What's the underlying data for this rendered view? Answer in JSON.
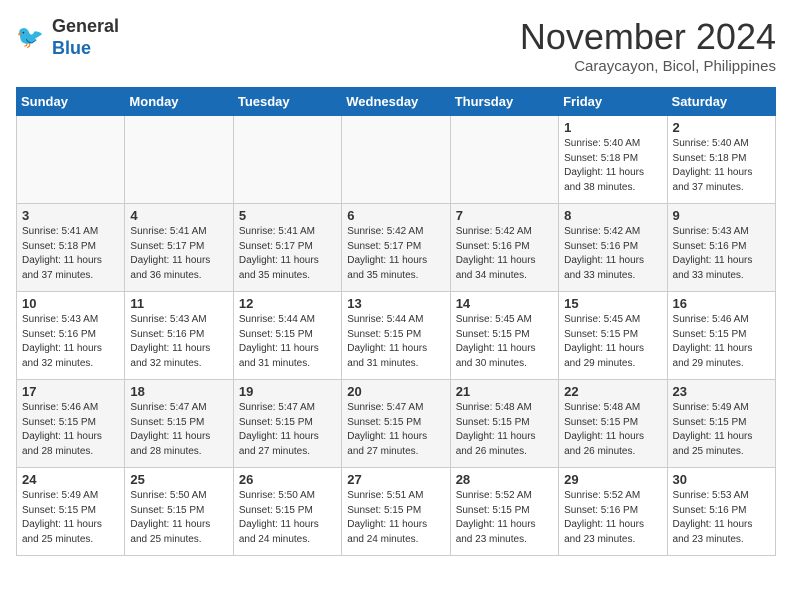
{
  "header": {
    "logo_line1": "General",
    "logo_line2": "Blue",
    "month": "November 2024",
    "location": "Caraycayon, Bicol, Philippines"
  },
  "weekdays": [
    "Sunday",
    "Monday",
    "Tuesday",
    "Wednesday",
    "Thursday",
    "Friday",
    "Saturday"
  ],
  "weeks": [
    [
      {
        "day": "",
        "info": ""
      },
      {
        "day": "",
        "info": ""
      },
      {
        "day": "",
        "info": ""
      },
      {
        "day": "",
        "info": ""
      },
      {
        "day": "",
        "info": ""
      },
      {
        "day": "1",
        "info": "Sunrise: 5:40 AM\nSunset: 5:18 PM\nDaylight: 11 hours\nand 38 minutes."
      },
      {
        "day": "2",
        "info": "Sunrise: 5:40 AM\nSunset: 5:18 PM\nDaylight: 11 hours\nand 37 minutes."
      }
    ],
    [
      {
        "day": "3",
        "info": "Sunrise: 5:41 AM\nSunset: 5:18 PM\nDaylight: 11 hours\nand 37 minutes."
      },
      {
        "day": "4",
        "info": "Sunrise: 5:41 AM\nSunset: 5:17 PM\nDaylight: 11 hours\nand 36 minutes."
      },
      {
        "day": "5",
        "info": "Sunrise: 5:41 AM\nSunset: 5:17 PM\nDaylight: 11 hours\nand 35 minutes."
      },
      {
        "day": "6",
        "info": "Sunrise: 5:42 AM\nSunset: 5:17 PM\nDaylight: 11 hours\nand 35 minutes."
      },
      {
        "day": "7",
        "info": "Sunrise: 5:42 AM\nSunset: 5:16 PM\nDaylight: 11 hours\nand 34 minutes."
      },
      {
        "day": "8",
        "info": "Sunrise: 5:42 AM\nSunset: 5:16 PM\nDaylight: 11 hours\nand 33 minutes."
      },
      {
        "day": "9",
        "info": "Sunrise: 5:43 AM\nSunset: 5:16 PM\nDaylight: 11 hours\nand 33 minutes."
      }
    ],
    [
      {
        "day": "10",
        "info": "Sunrise: 5:43 AM\nSunset: 5:16 PM\nDaylight: 11 hours\nand 32 minutes."
      },
      {
        "day": "11",
        "info": "Sunrise: 5:43 AM\nSunset: 5:16 PM\nDaylight: 11 hours\nand 32 minutes."
      },
      {
        "day": "12",
        "info": "Sunrise: 5:44 AM\nSunset: 5:15 PM\nDaylight: 11 hours\nand 31 minutes."
      },
      {
        "day": "13",
        "info": "Sunrise: 5:44 AM\nSunset: 5:15 PM\nDaylight: 11 hours\nand 31 minutes."
      },
      {
        "day": "14",
        "info": "Sunrise: 5:45 AM\nSunset: 5:15 PM\nDaylight: 11 hours\nand 30 minutes."
      },
      {
        "day": "15",
        "info": "Sunrise: 5:45 AM\nSunset: 5:15 PM\nDaylight: 11 hours\nand 29 minutes."
      },
      {
        "day": "16",
        "info": "Sunrise: 5:46 AM\nSunset: 5:15 PM\nDaylight: 11 hours\nand 29 minutes."
      }
    ],
    [
      {
        "day": "17",
        "info": "Sunrise: 5:46 AM\nSunset: 5:15 PM\nDaylight: 11 hours\nand 28 minutes."
      },
      {
        "day": "18",
        "info": "Sunrise: 5:47 AM\nSunset: 5:15 PM\nDaylight: 11 hours\nand 28 minutes."
      },
      {
        "day": "19",
        "info": "Sunrise: 5:47 AM\nSunset: 5:15 PM\nDaylight: 11 hours\nand 27 minutes."
      },
      {
        "day": "20",
        "info": "Sunrise: 5:47 AM\nSunset: 5:15 PM\nDaylight: 11 hours\nand 27 minutes."
      },
      {
        "day": "21",
        "info": "Sunrise: 5:48 AM\nSunset: 5:15 PM\nDaylight: 11 hours\nand 26 minutes."
      },
      {
        "day": "22",
        "info": "Sunrise: 5:48 AM\nSunset: 5:15 PM\nDaylight: 11 hours\nand 26 minutes."
      },
      {
        "day": "23",
        "info": "Sunrise: 5:49 AM\nSunset: 5:15 PM\nDaylight: 11 hours\nand 25 minutes."
      }
    ],
    [
      {
        "day": "24",
        "info": "Sunrise: 5:49 AM\nSunset: 5:15 PM\nDaylight: 11 hours\nand 25 minutes."
      },
      {
        "day": "25",
        "info": "Sunrise: 5:50 AM\nSunset: 5:15 PM\nDaylight: 11 hours\nand 25 minutes."
      },
      {
        "day": "26",
        "info": "Sunrise: 5:50 AM\nSunset: 5:15 PM\nDaylight: 11 hours\nand 24 minutes."
      },
      {
        "day": "27",
        "info": "Sunrise: 5:51 AM\nSunset: 5:15 PM\nDaylight: 11 hours\nand 24 minutes."
      },
      {
        "day": "28",
        "info": "Sunrise: 5:52 AM\nSunset: 5:15 PM\nDaylight: 11 hours\nand 23 minutes."
      },
      {
        "day": "29",
        "info": "Sunrise: 5:52 AM\nSunset: 5:16 PM\nDaylight: 11 hours\nand 23 minutes."
      },
      {
        "day": "30",
        "info": "Sunrise: 5:53 AM\nSunset: 5:16 PM\nDaylight: 11 hours\nand 23 minutes."
      }
    ]
  ]
}
